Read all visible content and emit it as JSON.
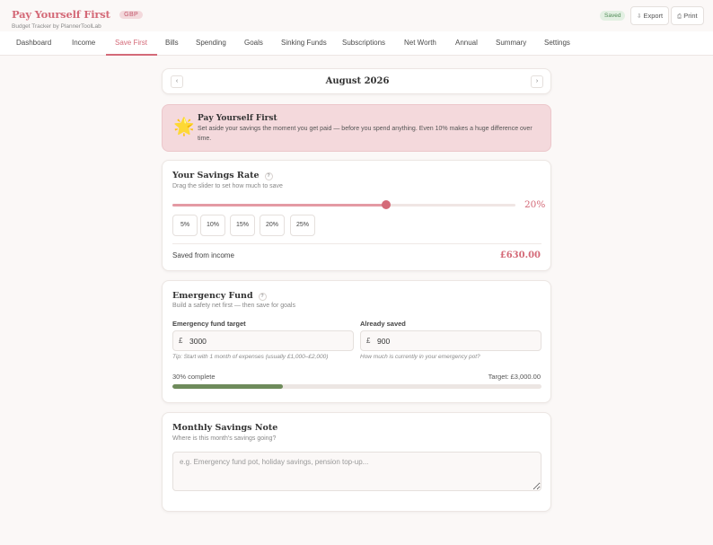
{
  "header": {
    "title": "Pay Yourself First",
    "currency_badge": "GBP",
    "subtitle": "Budget Tracker by PlannerToolLab",
    "saved_status": "Saved",
    "export_label": "Export",
    "print_label": "Print",
    "export_icon": "download-icon",
    "print_icon": "printer-icon"
  },
  "nav": {
    "items": [
      {
        "label": "Dashboard"
      },
      {
        "label": "Income"
      },
      {
        "label": "Save First"
      },
      {
        "label": "Bills"
      },
      {
        "label": "Spending"
      },
      {
        "label": "Goals"
      },
      {
        "label": "Sinking Funds"
      },
      {
        "label": "Subscriptions"
      },
      {
        "label": "Net Worth"
      },
      {
        "label": "Annual"
      },
      {
        "label": "Summary"
      },
      {
        "label": "Settings"
      }
    ],
    "active": "Save First"
  },
  "month": {
    "label": "August 2026",
    "prev": "‹",
    "next": "›"
  },
  "banner": {
    "icon": "🌟",
    "title": "Pay Yourself First",
    "text": "Set aside your savings the moment you get paid — before you spend anything. Even 10% makes a huge difference over time."
  },
  "savings_rate": {
    "title": "Your Savings Rate",
    "help": "?",
    "subtitle": "Drag the slider to set how much to save",
    "value_percent": 20,
    "value_label": "20%",
    "presets": [
      "5%",
      "10%",
      "15%",
      "20%",
      "25%"
    ],
    "saved_label": "Saved from income",
    "saved_amount": "£630.00"
  },
  "emergency_fund": {
    "title": "Emergency Fund",
    "help": "?",
    "subtitle": "Build a safety net first — then save for goals",
    "target_label": "Emergency fund target",
    "target_currency": "£",
    "target_value": "3000",
    "target_hint": "Tip: Start with 1 month of expenses (usually £1,000–£2,000)",
    "saved_label": "Already saved",
    "saved_currency": "£",
    "saved_value": "900",
    "saved_hint": "How much is currently in your emergency pot?",
    "progress_percent": 30,
    "progress_label": "30% complete",
    "target_text": "Target: £3,000.00"
  },
  "note": {
    "title": "Monthly Savings Note",
    "subtitle": "Where is this month's savings going?",
    "placeholder": "e.g. Emergency fund pot, holiday savings, pension top-up..."
  },
  "colors": {
    "accent": "#d46a78",
    "banner_bg": "#f4d9dc",
    "progress": "#6e8b5b",
    "saved_pill": "#e3f0e3"
  }
}
